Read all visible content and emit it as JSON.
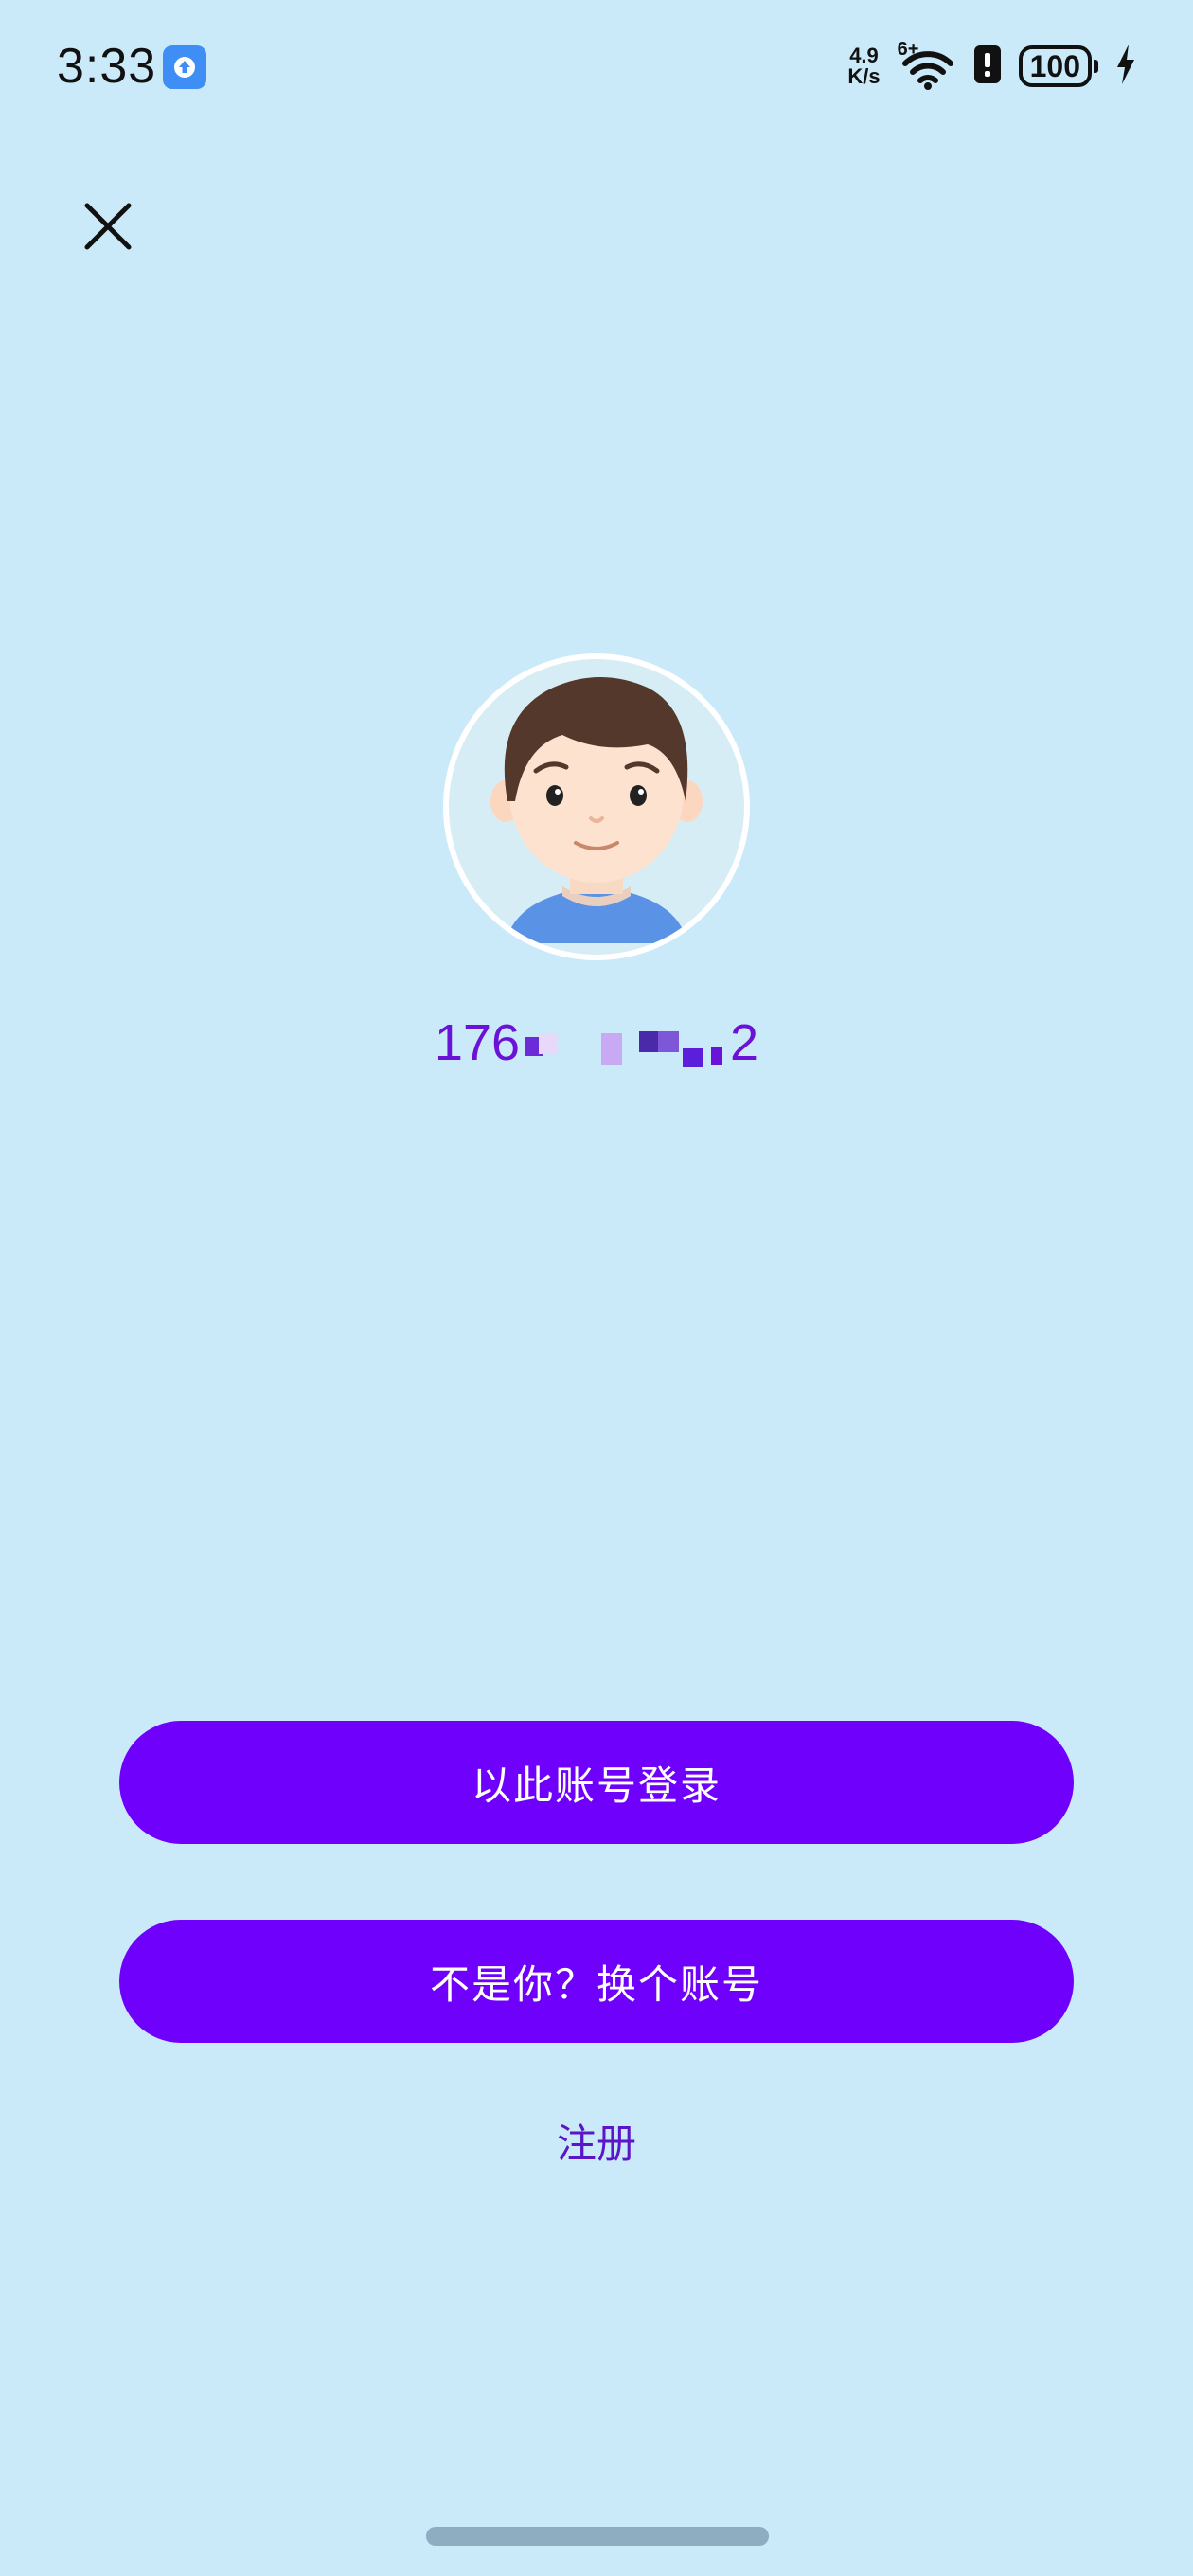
{
  "status_bar": {
    "time": "3:33",
    "net_speed_value": "4.9",
    "net_speed_unit": "K/s",
    "signal_label": "6+",
    "battery_level": "100",
    "app_icon": "upload-arrow-icon"
  },
  "header": {
    "close_icon": "close-icon"
  },
  "account": {
    "avatar_icon": "user-avatar-cartoon",
    "phone_prefix": "176",
    "phone_suffix": "2"
  },
  "actions": {
    "login_label": "以此账号登录",
    "switch_label": "不是你？换个账号",
    "register_label": "注册"
  },
  "colors": {
    "background": "#cbeaf9",
    "primary_button": "#6f00fb",
    "phone_text": "#6a13d6",
    "register_text": "#5a16c8"
  }
}
